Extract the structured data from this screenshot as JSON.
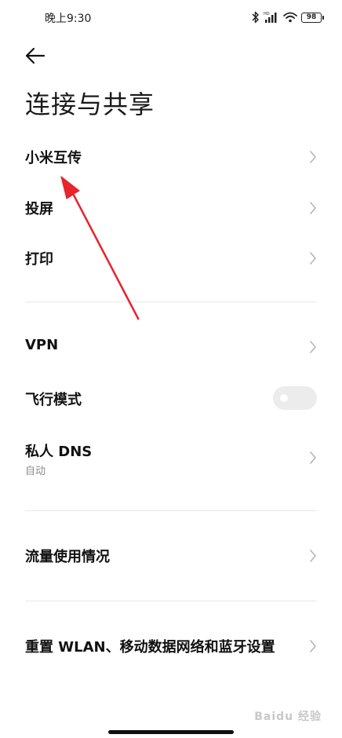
{
  "status_bar": {
    "time": "晚上9:30",
    "battery": "98",
    "icons": [
      "bluetooth-icon",
      "signal-icon",
      "wifi-icon",
      "battery-icon"
    ]
  },
  "header": {
    "back_icon": "back-arrow-icon",
    "title": "连接与共享"
  },
  "items": {
    "mi_share": {
      "label": "小米互传"
    },
    "cast": {
      "label": "投屏"
    },
    "print": {
      "label": "打印"
    },
    "vpn": {
      "label": "VPN"
    },
    "airplane": {
      "label": "飞行模式",
      "toggle_on": false
    },
    "private_dns": {
      "label": "私人 DNS",
      "subtitle": "自动"
    },
    "data_usage": {
      "label": "流量使用情况"
    },
    "reset": {
      "label": "重置 WLAN、移动数据网络和蓝牙设置"
    }
  },
  "watermark": "Baidu 经验",
  "colors": {
    "annotation_arrow": "#e8242c",
    "chevron": "#b5b5b5",
    "toggle_off": "#ececec",
    "divider": "#e9e9e9"
  }
}
